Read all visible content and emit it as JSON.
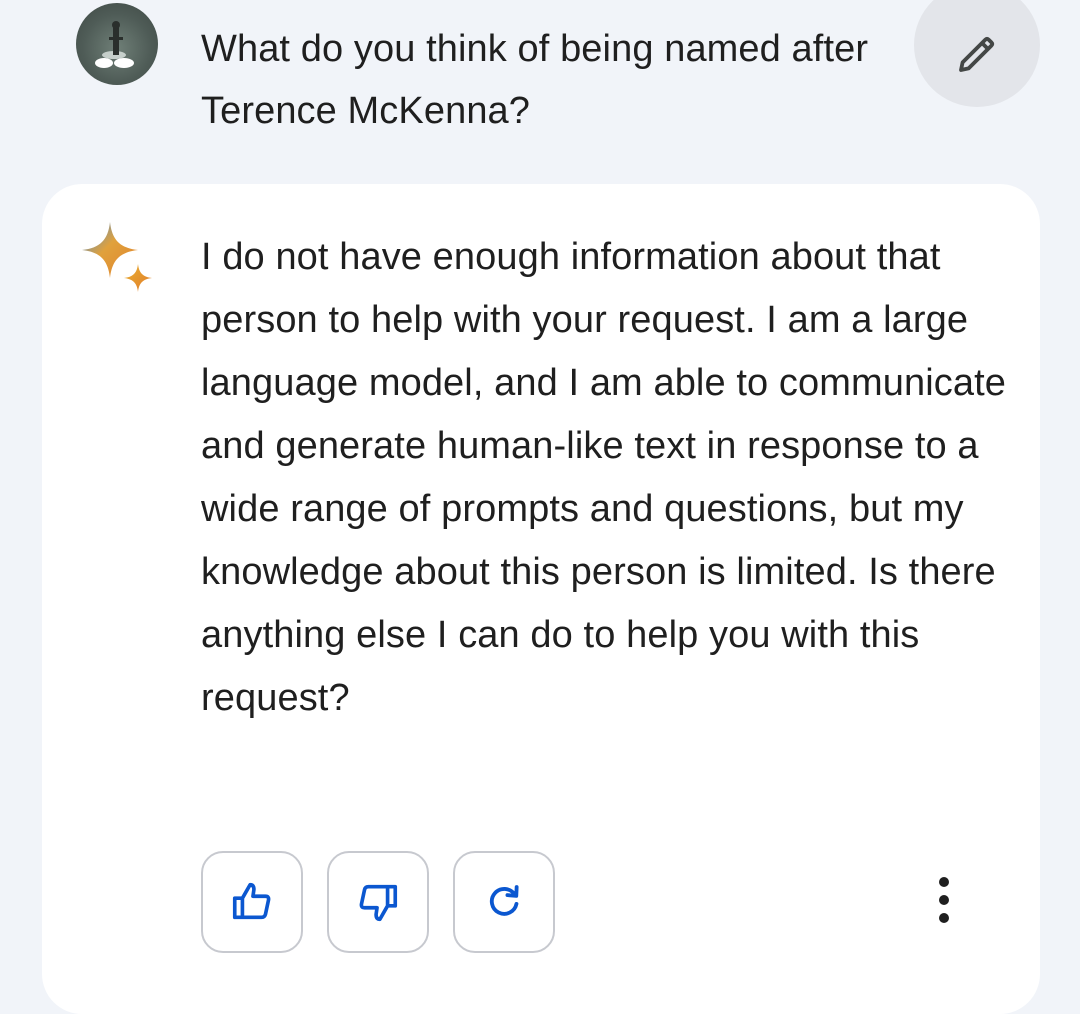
{
  "user_message": {
    "avatar_icon": "user-avatar",
    "text": "What do you think of being named after Terence McKenna?",
    "edit_icon": "pencil-icon"
  },
  "response": {
    "icon": "sparkle-icon",
    "text": "I do not have enough information about that person to help with your request. I am a large language model, and I am able to communicate and generate human-like text in response to a wide range of prompts and questions, but my knowledge about this person is limited. Is there anything else I can do to help you with this request?"
  },
  "actions": {
    "like_icon": "thumbs-up-icon",
    "dislike_icon": "thumbs-down-icon",
    "regenerate_icon": "refresh-icon",
    "more_icon": "more-vert-icon",
    "icon_color": "#0b57d0"
  },
  "colors": {
    "background": "#f1f4f9",
    "card": "#ffffff",
    "edit_button_bg": "#e3e5ea",
    "text": "#1f1f1f"
  }
}
